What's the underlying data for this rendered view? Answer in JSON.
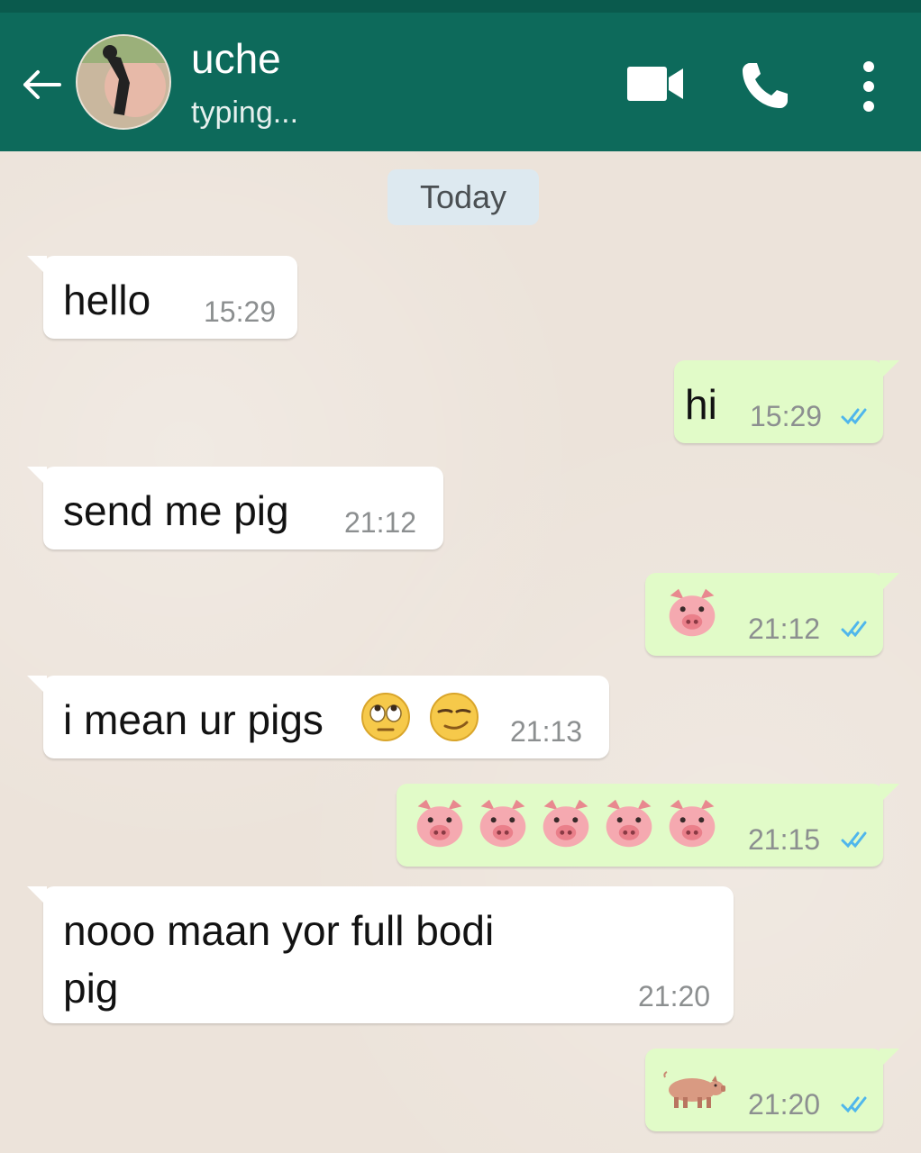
{
  "header": {
    "contact_name": "uche",
    "contact_status": "typing...",
    "icons": [
      "back-arrow-icon",
      "video-call-icon",
      "voice-call-icon",
      "more-options-icon"
    ]
  },
  "chat": {
    "date_label": "Today",
    "messages": [
      {
        "direction": "in",
        "text": "hello",
        "time": "15:29"
      },
      {
        "direction": "out",
        "text": "hi",
        "time": "15:29",
        "read": true
      },
      {
        "direction": "in",
        "text": "send me pig",
        "time": "21:12"
      },
      {
        "direction": "out",
        "emoji": "pig-face",
        "emoji_count": 1,
        "time": "21:12",
        "read": true
      },
      {
        "direction": "in",
        "text": "i mean ur pigs",
        "emojis": [
          "face-with-rolling-eyes",
          "smirking-face"
        ],
        "time": "21:13"
      },
      {
        "direction": "out",
        "emoji": "pig-face",
        "emoji_count": 5,
        "time": "21:15",
        "read": true
      },
      {
        "direction": "in",
        "lines": [
          "nooo maan yor full bodi",
          "pig"
        ],
        "time": "21:20"
      },
      {
        "direction": "out",
        "emoji": "pig",
        "emoji_count": 1,
        "time": "21:20",
        "read": true
      }
    ]
  },
  "colors": {
    "header": "#0d6a5b",
    "chat_background": "#ece3da",
    "incoming_bubble": "#ffffff",
    "outgoing_bubble": "#e1fbc8",
    "read_ticks": "#4fb6ec",
    "date_chip": "#dde9f0"
  }
}
